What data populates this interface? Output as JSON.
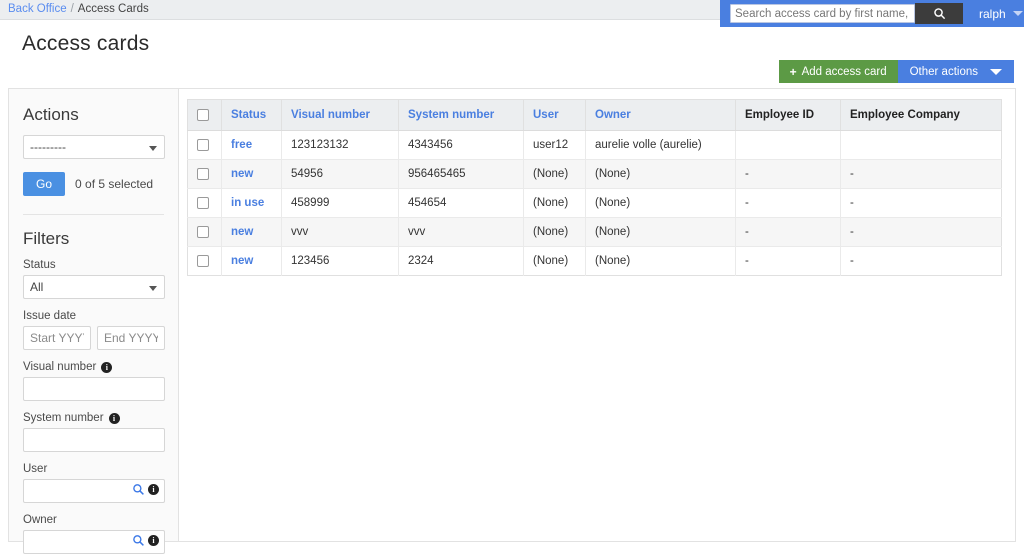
{
  "breadcrumb": {
    "root": "Back Office",
    "separator": "/",
    "current": "Access Cards"
  },
  "search": {
    "placeholder": "Search access card by first name, last name...",
    "value": "",
    "button_icon": "search-icon"
  },
  "user": {
    "name": "ralph",
    "caret_icon": "chevron-down-icon"
  },
  "page": {
    "title": "Access cards"
  },
  "toolbar": {
    "add_label": "Add access card",
    "add_plus": "+",
    "other_label": "Other actions",
    "other_caret_icon": "chevron-down-icon",
    "add_color": "#5c9a45",
    "other_color": "#4a7fe0"
  },
  "sidebar": {
    "actions_title": "Actions",
    "action_select_value": "---------",
    "go_label": "Go",
    "selected_text": "0 of 5 selected",
    "filters_title": "Filters",
    "filters": {
      "status_label": "Status",
      "status_value": "All",
      "issue_date_label": "Issue date",
      "issue_start_placeholder": "Start YYYY-MM-DD",
      "issue_end_placeholder": "End YYYY-MM-DD",
      "issue_start_value": "",
      "issue_end_value": "",
      "visual_number_label": "Visual number",
      "visual_number_value": "",
      "system_number_label": "System number",
      "system_number_value": "",
      "user_label": "User",
      "user_value": "",
      "owner_label": "Owner",
      "owner_value": ""
    }
  },
  "table": {
    "columns": [
      {
        "key": "checkbox",
        "label": "",
        "link": false
      },
      {
        "key": "status",
        "label": "Status",
        "link": true
      },
      {
        "key": "visual_number",
        "label": "Visual number",
        "link": true
      },
      {
        "key": "system_number",
        "label": "System number",
        "link": true
      },
      {
        "key": "user",
        "label": "User",
        "link": true
      },
      {
        "key": "owner",
        "label": "Owner",
        "link": true
      },
      {
        "key": "employee_id",
        "label": "Employee ID",
        "link": false
      },
      {
        "key": "employee_company",
        "label": "Employee Company",
        "link": false
      }
    ],
    "rows": [
      {
        "status": "free",
        "visual_number": "123123132",
        "system_number": "4343456",
        "user": "user12",
        "owner": "aurelie volle (aurelie)",
        "employee_id": "",
        "employee_company": ""
      },
      {
        "status": "new",
        "visual_number": "54956",
        "system_number": "956465465",
        "user": "(None)",
        "owner": "(None)",
        "employee_id": "-",
        "employee_company": "-"
      },
      {
        "status": "in use",
        "visual_number": "458999",
        "system_number": "454654",
        "user": "(None)",
        "owner": "(None)",
        "employee_id": "-",
        "employee_company": "-"
      },
      {
        "status": "new",
        "visual_number": "vvv",
        "system_number": "vvv",
        "user": "(None)",
        "owner": "(None)",
        "employee_id": "-",
        "employee_company": "-"
      },
      {
        "status": "new",
        "visual_number": "123456",
        "system_number": "2324",
        "user": "(None)",
        "owner": "(None)",
        "employee_id": "-",
        "employee_company": "-"
      }
    ]
  },
  "colors": {
    "link": "#4a7fe0",
    "header_bg": "#eceef0",
    "accent_green": "#5c9a45"
  }
}
